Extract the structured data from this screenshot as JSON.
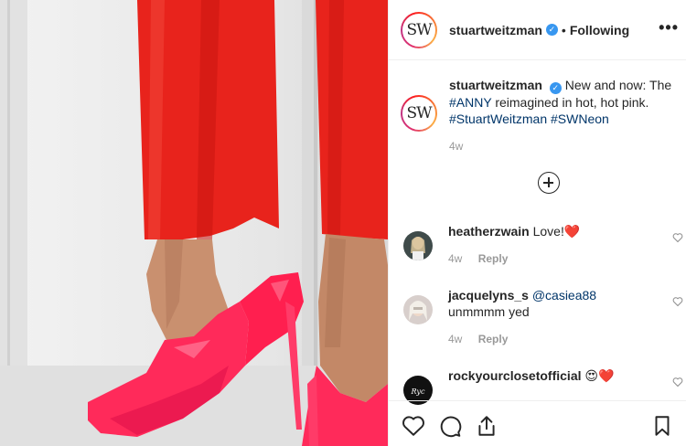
{
  "post": {
    "author": "stuartweitzman",
    "avatar_initials": "SW",
    "separator": "•",
    "follow_status": "Following",
    "more_icon": "more-horizontal-icon"
  },
  "caption": {
    "user": "stuartweitzman",
    "text_before": "New and now: The",
    "hashtag_1": "#ANNY",
    "text_middle": "reimagined in hot, hot pink.",
    "hashtag_2": "#StuartWeitzman",
    "hashtag_3": "#SWNeon",
    "time": "4w"
  },
  "load_more_icon": "plus-circle-icon",
  "comments": [
    {
      "user": "heatherzwain",
      "text": "Love!❤️",
      "time": "4w",
      "reply": "Reply"
    },
    {
      "user": "jacquelyns_s",
      "mention": "@casiea88",
      "text": "unmmmm yed",
      "time": "4w",
      "reply": "Reply"
    },
    {
      "user": "rockyourclosetofficial",
      "text": "😍❤️"
    }
  ],
  "colors": {
    "link": "#003569",
    "verified": "#3897f0",
    "muted": "#999999",
    "pants_red": "#e8231c",
    "shoe_pink": "#ff2a5a"
  }
}
